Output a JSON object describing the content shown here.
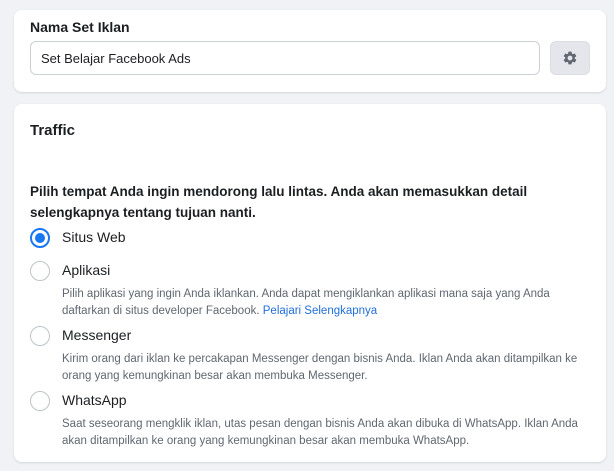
{
  "set_name": {
    "label": "Nama Set Iklan",
    "value": "Set Belajar Facebook Ads"
  },
  "traffic": {
    "title": "Traffic",
    "prompt": "Pilih tempat Anda ingin mendorong lalu lintas. Anda akan memasukkan detail selengkapnya tentang tujuan nanti.",
    "options": [
      {
        "label": "Situs Web",
        "selected": true
      },
      {
        "label": "Aplikasi",
        "selected": false,
        "description": "Pilih aplikasi yang ingin Anda iklankan. Anda dapat mengiklankan aplikasi mana saja yang Anda daftarkan di situs developer Facebook.",
        "link": "Pelajari Selengkapnya"
      },
      {
        "label": "Messenger",
        "selected": false,
        "description": "Kirim orang dari iklan ke percakapan Messenger dengan bisnis Anda. Iklan Anda akan ditampilkan ke orang yang kemungkinan besar akan membuka Messenger."
      },
      {
        "label": "WhatsApp",
        "selected": false,
        "description": "Saat seseorang mengklik iklan, utas pesan dengan bisnis Anda akan dibuka di WhatsApp. Iklan Anda akan ditampilkan ke orang yang kemungkinan besar akan membuka WhatsApp."
      }
    ]
  },
  "icons": {
    "settings": "gear-icon"
  },
  "colors": {
    "accent": "#1877f2",
    "link": "#216fdb",
    "background": "#f0f2f5"
  }
}
